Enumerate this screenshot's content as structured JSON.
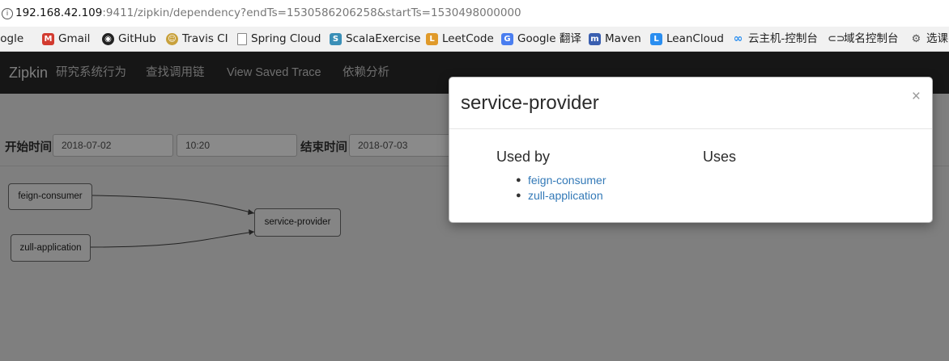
{
  "browser": {
    "url_host": "192.168.42.109",
    "url_rest": ":9411/zipkin/dependency?endTs=1530586206258&startTs=1530498000000",
    "bookmarks": [
      {
        "label": "oogle",
        "icon": "google-icon",
        "color": "#4a4a4a"
      },
      {
        "label": "Gmail",
        "icon": "gmail-icon",
        "color": "#d23b30"
      },
      {
        "label": "GitHub",
        "icon": "github-icon",
        "color": "#222222"
      },
      {
        "label": "Travis CI",
        "icon": "travis-icon",
        "color": "#c8a13c"
      },
      {
        "label": "Spring Cloud",
        "icon": "page-icon",
        "color": "#888888"
      },
      {
        "label": "ScalaExercise",
        "icon": "scala-icon",
        "color": "#3a8fb7"
      },
      {
        "label": "LeetCode",
        "icon": "leetcode-icon",
        "color": "#e09a2a"
      },
      {
        "label": "Google 翻译",
        "icon": "translate-icon",
        "color": "#4a7ef0"
      },
      {
        "label": "Maven",
        "icon": "maven-icon",
        "color": "#3a5fb0"
      },
      {
        "label": "LeanCloud",
        "icon": "leancloud-icon",
        "color": "#2a8ef0"
      },
      {
        "label": "云主机-控制台",
        "icon": "cloud-icon",
        "color": "#2a8ef0"
      },
      {
        "label": "域名控制台",
        "icon": "link-icon",
        "color": "#555555"
      },
      {
        "label": "选课",
        "icon": "gear-icon",
        "color": "#555555"
      }
    ]
  },
  "navbar": {
    "brand": "Zipkin",
    "items": [
      "研究系统行为",
      "查找调用链",
      "View Saved Trace",
      "依赖分析"
    ]
  },
  "form": {
    "start_label": "开始时间",
    "start_date": "2018-07-02",
    "start_time": "10:20",
    "end_label": "结束时间",
    "end_date": "2018-07-03"
  },
  "graph": {
    "nodes": [
      "feign-consumer",
      "zull-application",
      "service-provider"
    ]
  },
  "modal": {
    "title": "service-provider",
    "close": "×",
    "used_by_header": "Used by",
    "uses_header": "Uses",
    "used_by": [
      "feign-consumer",
      "zull-application"
    ]
  }
}
